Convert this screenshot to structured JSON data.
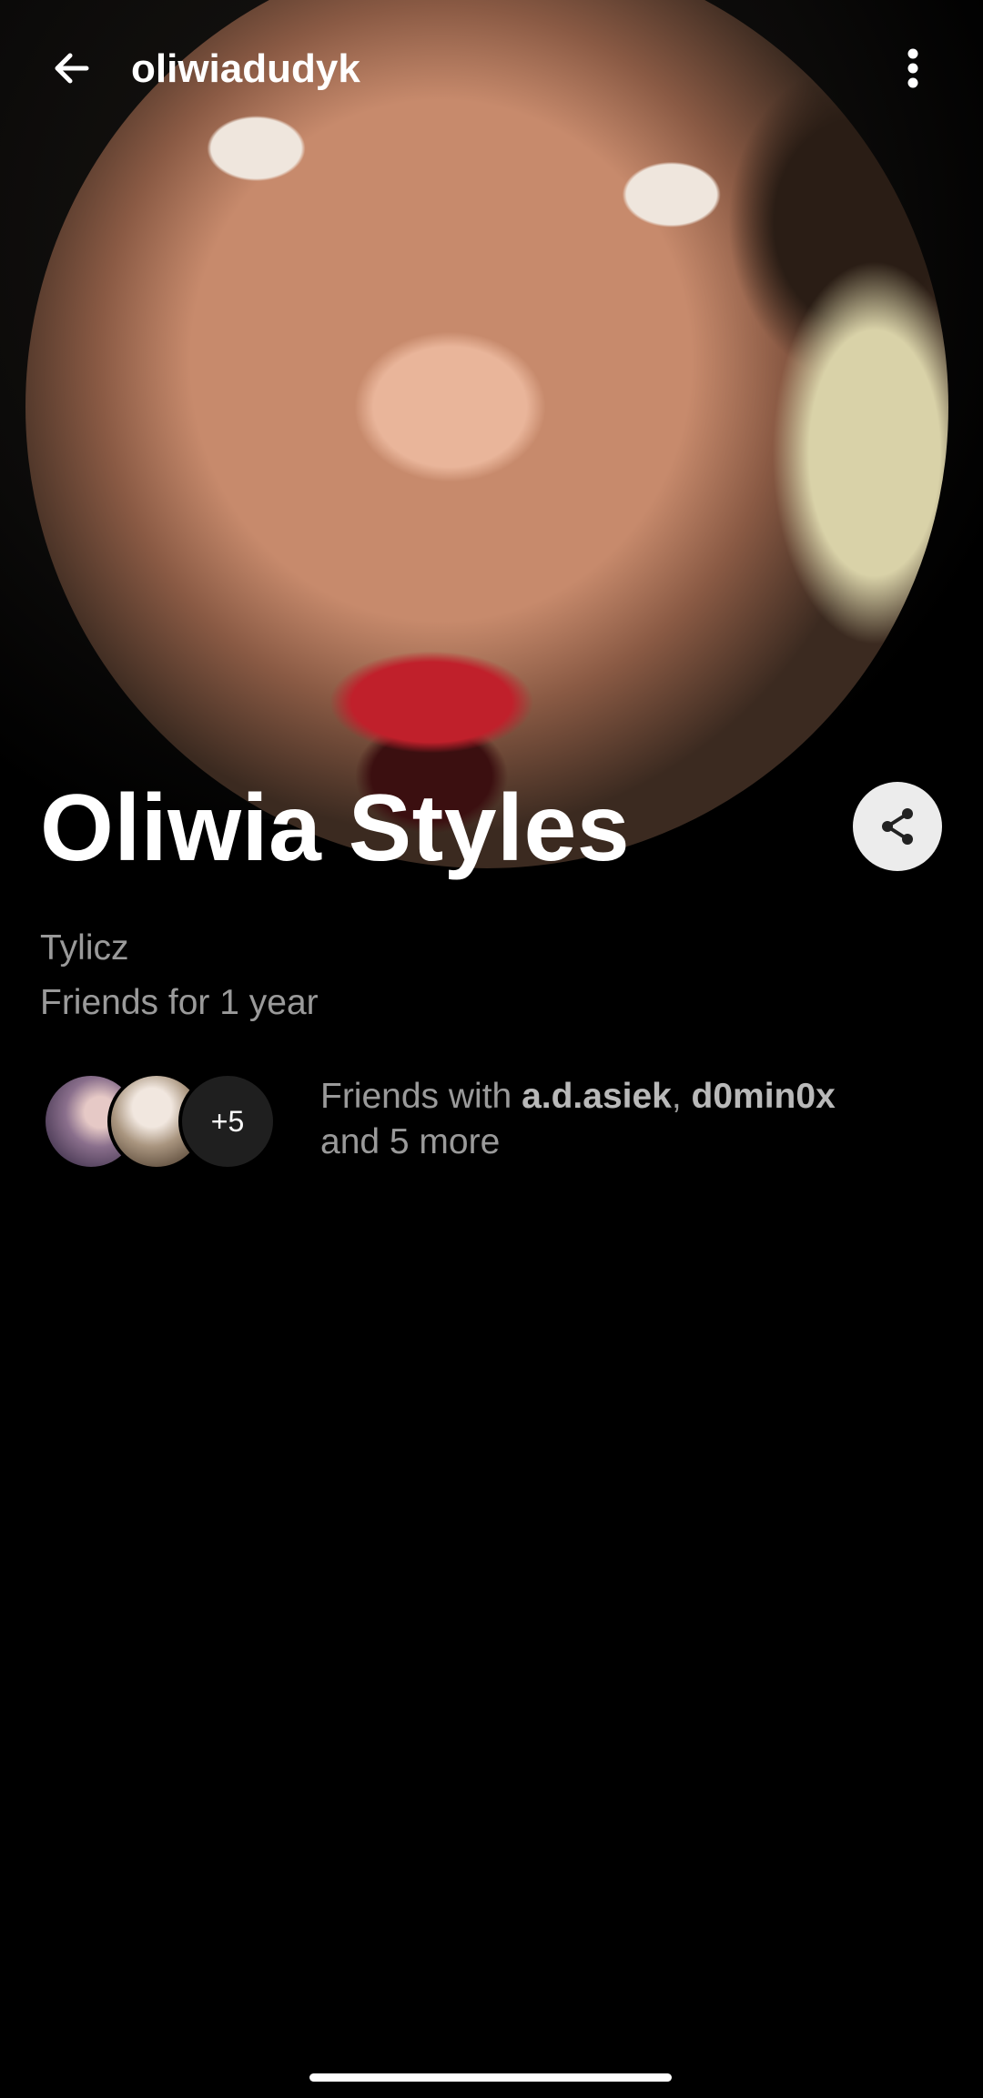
{
  "header": {
    "username": "oliwiadudyk",
    "back_icon": "arrow-left-icon",
    "more_icon": "more-vertical-icon"
  },
  "profile": {
    "display_name": "Oliwia Styles",
    "location": "Tylicz",
    "friends_since": "Friends for 1 year",
    "share_icon": "share-icon"
  },
  "mutuals": {
    "more_badge": "+5",
    "prefix": "Friends with ",
    "friend1": "a.d.asiek",
    "separator": ", ",
    "friend2": "d0min0x",
    "suffix": "and 5 more"
  },
  "colors": {
    "background": "#000000",
    "secondary_text": "#9a9a9a",
    "share_button_bg": "#ececec"
  }
}
